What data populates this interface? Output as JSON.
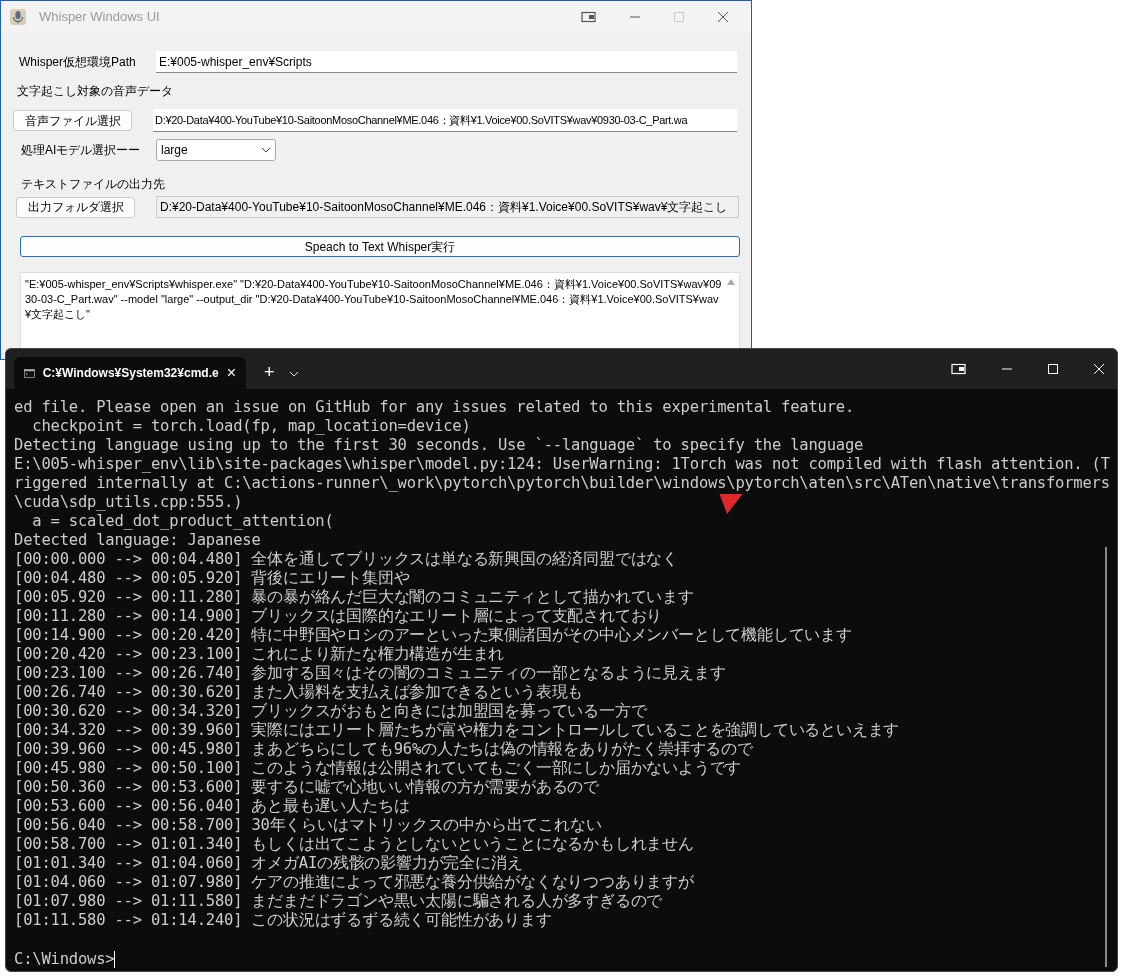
{
  "gui": {
    "title": "Whisper Windows UI",
    "path_label": "Whisper仮想環境Path",
    "path_value": "E:¥005-whisper_env¥Scripts",
    "audio_label": "文字起こし対象の音声データ",
    "audio_button": "音声ファイル選択",
    "audio_value": "D:¥20-Data¥400-YouTube¥10-SaitoonMosoChannel¥ME.046：資料¥1.Voice¥00.SoVITS¥wav¥0930-03-C_Part.wa",
    "model_label": "処理AIモデル選択ーー",
    "model_value": "large",
    "output_label": "テキストファイルの出力先",
    "output_button": "出力フォルダ選択",
    "output_value": "D:¥20-Data¥400-YouTube¥10-SaitoonMosoChannel¥ME.046：資料¥1.Voice¥00.SoVITS¥wav¥文字起こし",
    "run_button": "Speach to Text Whisper実行",
    "log": "\"E:¥005-whisper_env¥Scripts¥whisper.exe\" \"D:¥20-Data¥400-YouTube¥10-SaitoonMosoChannel¥ME.046：資料¥1.Voice¥00.SoVITS¥wav¥0930-03-C_Part.wav\" --model \"large\" --output_dir \"D:¥20-Data¥400-YouTube¥10-SaitoonMosoChannel¥ME.046：資料¥1.Voice¥00.SoVITS¥wav¥文字起こし\""
  },
  "terminal": {
    "tab_title": "C:¥Windows¥System32¥cmd.e",
    "tab_close": "×",
    "new_tab": "+",
    "lines": [
      "ed file. Please open an issue on GitHub for any issues related to this experimental feature.",
      "  checkpoint = torch.load(fp, map_location=device)",
      "Detecting language using up to the first 30 seconds. Use `--language` to specify the language",
      "E:\\005-whisper_env\\lib\\site-packages\\whisper\\model.py:124: UserWarning: 1Torch was not compiled with flash attention. (T",
      "riggered internally at C:\\actions-runner\\_work\\pytorch\\pytorch\\builder\\windows\\pytorch\\aten\\src\\ATen\\native\\transformers",
      "\\cuda\\sdp_utils.cpp:555.)",
      "  a = scaled_dot_product_attention(",
      "Detected language: Japanese",
      "[00:00.000 --> 00:04.480] 全体を通してブリックスは単なる新興国の経済同盟ではなく",
      "[00:04.480 --> 00:05.920] 背後にエリート集団や",
      "[00:05.920 --> 00:11.280] 暴の暴が絡んだ巨大な闇のコミュニティとして描かれています",
      "[00:11.280 --> 00:14.900] ブリックスは国際的なエリート層によって支配されており",
      "[00:14.900 --> 00:20.420] 特に中野国やロシのアーといった東側諸国がその中心メンバーとして機能しています",
      "[00:20.420 --> 00:23.100] これにより新たな権力構造が生まれ",
      "[00:23.100 --> 00:26.740] 参加する国々はその闇のコミュニティの一部となるように見えます",
      "[00:26.740 --> 00:30.620] また入場料を支払えば参加できるという表現も",
      "[00:30.620 --> 00:34.320] ブリックスがおもと向きには加盟国を募っている一方で",
      "[00:34.320 --> 00:39.960] 実際にはエリート層たちが富や権力をコントロールしていることを強調しているといえます",
      "[00:39.960 --> 00:45.980] まあどちらにしても96%の人たちは偽の情報をありがたく崇拝するので",
      "[00:45.980 --> 00:50.100] このような情報は公開されていてもごく一部にしか届かないようです",
      "[00:50.360 --> 00:53.600] 要するに嘘で心地いい情報の方が需要があるので",
      "[00:53.600 --> 00:56.040] あと最も遅い人たちは",
      "[00:56.040 --> 00:58.700] 30年くらいはマトリックスの中から出てこれない",
      "[00:58.700 --> 01:01.340] もしくは出てこようとしないということになるかもしれません",
      "[01:01.340 --> 01:04.060] オメガAIの残骸の影響力が完全に消え",
      "[01:04.060 --> 01:07.980] ケアの推進によって邪悪な養分供給がなくなりつつありますが",
      "[01:07.980 --> 01:11.580] まだまだドラゴンや黒い太陽に騙される人が多すぎるので",
      "[01:11.580 --> 01:14.240] この状況はずるずる続く可能性があります"
    ],
    "prompt": "C:\\Windows>"
  }
}
